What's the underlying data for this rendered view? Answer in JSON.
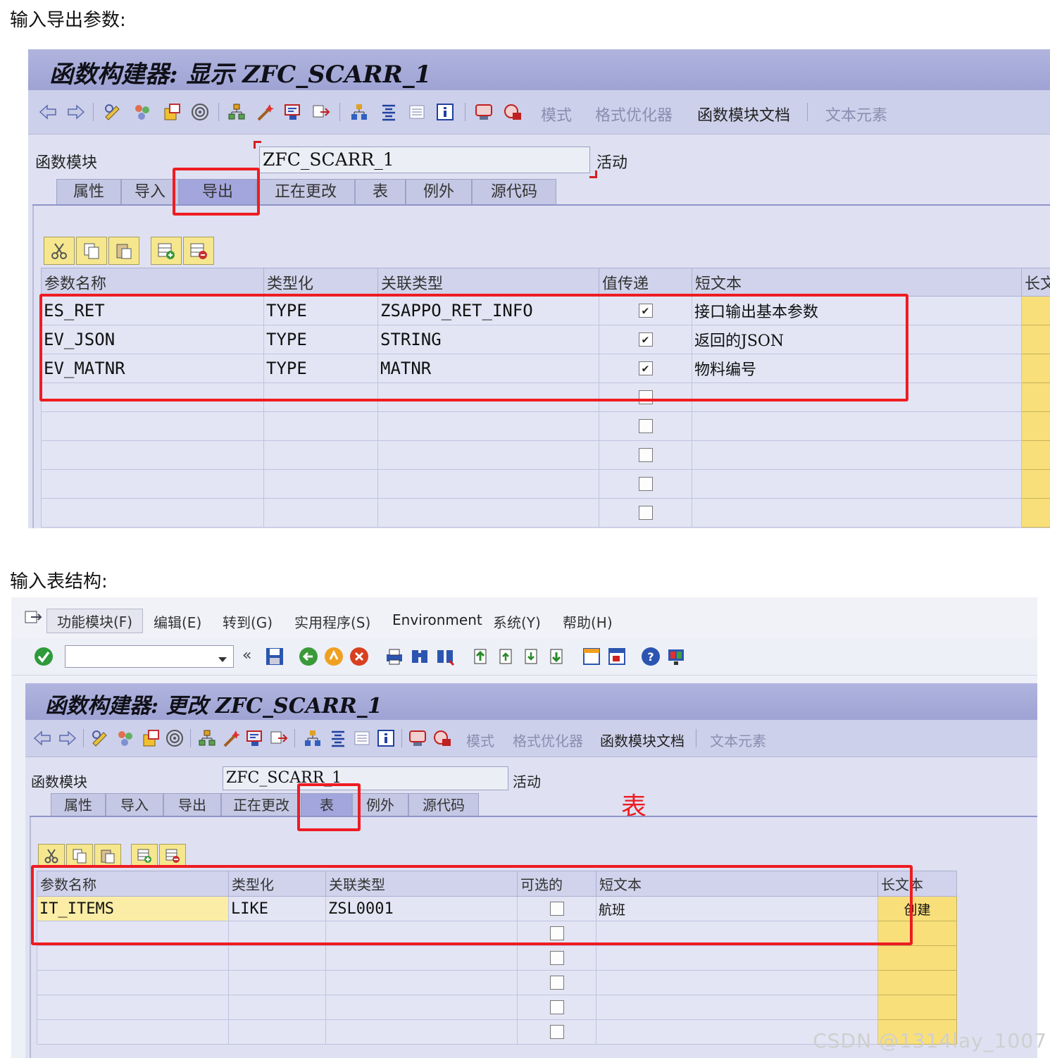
{
  "section1": {
    "heading": "输入导出参数:"
  },
  "section2": {
    "heading": "输入表结构:"
  },
  "fb1": {
    "title": "函数构建器: 显示 ZFC_SCARR_1",
    "toolbar_texts": [
      "模式",
      "格式优化器",
      "函数模块文档",
      "文本元素"
    ],
    "field_label": "函数模块",
    "field_value": "ZFC_SCARR_1",
    "field_status": "活动",
    "tabs": [
      "属性",
      "导入",
      "导出",
      "正在更改",
      "表",
      "例外",
      "源代码"
    ],
    "active_tab": "导出",
    "columns": [
      "参数名称",
      "类型化",
      "关联类型",
      "值传递",
      "短文本",
      "长文"
    ],
    "rows": [
      {
        "name": "ES_RET",
        "typing": "TYPE",
        "ref": "ZSAPPO_RET_INFO",
        "checked": true,
        "short": "接口输出基本参数"
      },
      {
        "name": "EV_JSON",
        "typing": "TYPE",
        "ref": "STRING",
        "checked": true,
        "short": "返回的JSON"
      },
      {
        "name": "EV_MATNR",
        "typing": "TYPE",
        "ref": "MATNR",
        "checked": true,
        "short": "物料编号"
      },
      {
        "name": "",
        "typing": "",
        "ref": "",
        "checked": false,
        "short": ""
      },
      {
        "name": "",
        "typing": "",
        "ref": "",
        "checked": false,
        "short": ""
      },
      {
        "name": "",
        "typing": "",
        "ref": "",
        "checked": false,
        "short": ""
      },
      {
        "name": "",
        "typing": "",
        "ref": "",
        "checked": false,
        "short": ""
      },
      {
        "name": "",
        "typing": "",
        "ref": "",
        "checked": false,
        "short": ""
      }
    ]
  },
  "sap2": {
    "menu": [
      "功能模块(F)",
      "编辑(E)",
      "转到(G)",
      "实用程序(S)",
      "Environment",
      "系统(Y)",
      "帮助(H)"
    ]
  },
  "fb2": {
    "title": "函数构建器: 更改 ZFC_SCARR_1",
    "toolbar_texts": [
      "模式",
      "格式优化器",
      "函数模块文档",
      "文本元素"
    ],
    "field_label": "函数模块",
    "field_value": "ZFC_SCARR_1",
    "field_status": "活动",
    "tabs": [
      "属性",
      "导入",
      "导出",
      "正在更改",
      "表",
      "例外",
      "源代码"
    ],
    "active_tab": "表",
    "annotation": "表",
    "columns": [
      "参数名称",
      "类型化",
      "关联类型",
      "可选的",
      "短文本",
      "长文本"
    ],
    "rows": [
      {
        "name": "IT_ITEMS",
        "typing": "LIKE",
        "ref": "ZSL0001",
        "checked": false,
        "short": "航班",
        "long": "创建"
      },
      {
        "name": "",
        "typing": "",
        "ref": "",
        "checked": false,
        "short": "",
        "long": ""
      },
      {
        "name": "",
        "typing": "",
        "ref": "",
        "checked": false,
        "short": "",
        "long": ""
      },
      {
        "name": "",
        "typing": "",
        "ref": "",
        "checked": false,
        "short": "",
        "long": ""
      },
      {
        "name": "",
        "typing": "",
        "ref": "",
        "checked": false,
        "short": "",
        "long": ""
      },
      {
        "name": "",
        "typing": "",
        "ref": "",
        "checked": false,
        "short": "",
        "long": ""
      }
    ]
  },
  "watermark": "CSDN @1314lay_1007",
  "colors": {
    "annotation_red": "#ee1c22",
    "title_bar": "#a3a7d8",
    "panel_bg": "#dfe1f2",
    "long_text_cell": "#f8df7a"
  }
}
